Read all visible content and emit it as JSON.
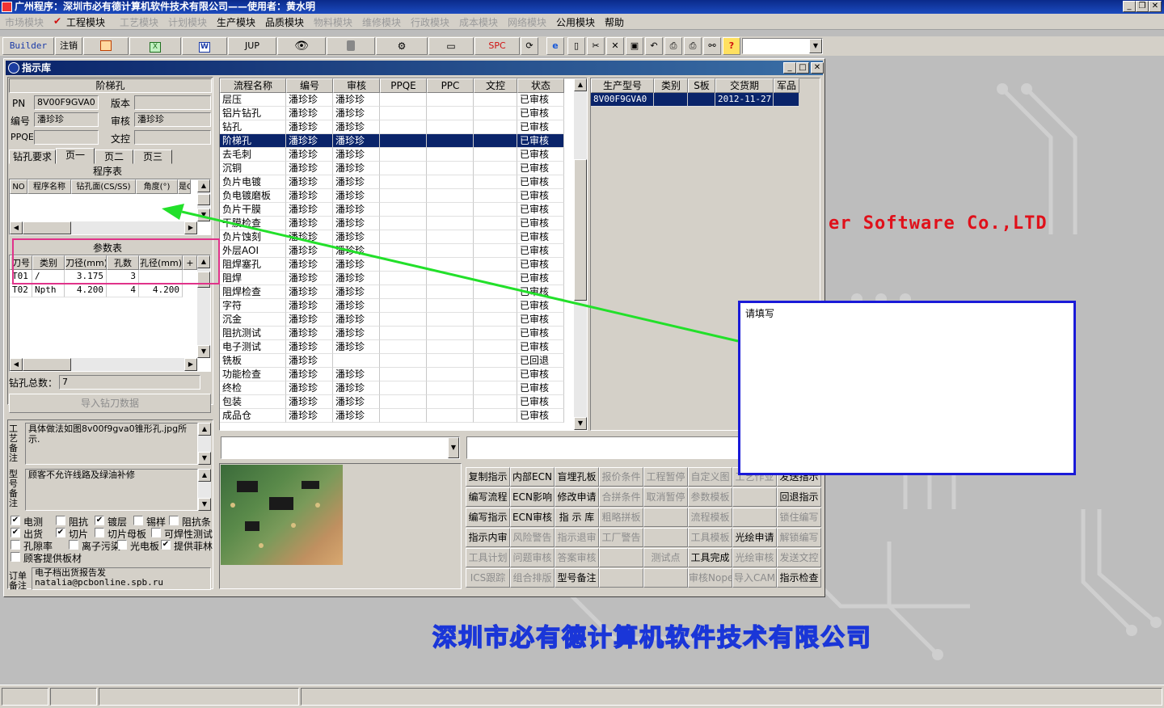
{
  "app": {
    "title": "广州程序：深圳市必有德计算机软件技术有限公司——使用者：黄水明"
  },
  "menu": [
    {
      "label": "市场模块",
      "enabled": false
    },
    {
      "label": "工程模块",
      "enabled": true,
      "checked": true
    },
    {
      "label": "工艺模块",
      "enabled": false
    },
    {
      "label": "计划模块",
      "enabled": false
    },
    {
      "label": "生产模块",
      "enabled": true
    },
    {
      "label": "品质模块",
      "enabled": true
    },
    {
      "label": "物料模块",
      "enabled": false
    },
    {
      "label": "维修模块",
      "enabled": false
    },
    {
      "label": "行政模块",
      "enabled": false
    },
    {
      "label": "成本模块",
      "enabled": false
    },
    {
      "label": "网络模块",
      "enabled": false
    },
    {
      "label": "公用模块",
      "enabled": true
    },
    {
      "label": "帮助",
      "enabled": true
    }
  ],
  "toolbar": {
    "builder": "Builder",
    "logout": "注销",
    "jup": "JUP",
    "spc": "SPC",
    "combo_value": ""
  },
  "window": {
    "title": "指示库"
  },
  "left": {
    "product_type": "阶梯孔",
    "pn_label": "PN",
    "pn_value": "8V00F9GVA0",
    "version_label": "版本",
    "version_value": "",
    "editor_label": "编号",
    "editor_value": "潘珍珍",
    "review_label": "审核",
    "review_value": "潘珍珍",
    "ppqe_label": "PPQE",
    "ppqe_value": "",
    "doc_label": "文控",
    "doc_value": "",
    "tabs": [
      "钻孔要求",
      "页一",
      "页二",
      "页三"
    ],
    "program_table_title": "程序表",
    "program_cols": [
      "NO",
      "程序名称",
      "钻孔面(CS/SS)",
      "角度(°)",
      "是Q"
    ],
    "param_table_title": "参数表",
    "param_cols": [
      "刀号",
      "类别",
      "刀径(mm)",
      "孔数",
      "孔径(mm)",
      "+"
    ],
    "param_rows": [
      [
        "T01",
        "/",
        "3.175",
        "3",
        ""
      ],
      [
        "T02",
        "Npth",
        "4.200",
        "4",
        "4.200"
      ]
    ],
    "drill_total_label": "钻孔总数：",
    "drill_total_value": "7",
    "import_button": "导入钻刀数据",
    "process_note_label": "工艺备注",
    "process_note": "具体做法如图8v00f9gva0锥形孔.jpg所示.",
    "type_note_label": "型号备注",
    "type_note": "顾客不允许线路及绿油补修",
    "checkboxes": [
      {
        "label": "电测",
        "checked": true
      },
      {
        "label": "阻抗",
        "checked": false
      },
      {
        "label": "镀层",
        "checked": true
      },
      {
        "label": "锡样",
        "checked": false
      },
      {
        "label": "阻抗条",
        "checked": false
      },
      {
        "label": "出货",
        "checked": true
      },
      {
        "label": "切片",
        "checked": true
      },
      {
        "label": "切片母板",
        "checked": false
      },
      {
        "label": "可焊性测试",
        "checked": false
      },
      {
        "label": "孔隙率",
        "checked": false
      },
      {
        "label": "离子污染",
        "checked": false
      },
      {
        "label": "光电板",
        "checked": false
      },
      {
        "label": "提供菲林",
        "checked": true
      },
      {
        "label": "顾客提供板材",
        "checked": false
      }
    ],
    "order_note_label": "订单备注",
    "order_note": "电子档出货报告发\nnatalia@pcbonline.spb.ru"
  },
  "flow": {
    "cols": [
      "流程名称",
      "编号",
      "审核",
      "PPQE",
      "PPC",
      "文控",
      "状态"
    ],
    "rows": [
      [
        "层压",
        "潘珍珍",
        "潘珍珍",
        "",
        "",
        "",
        "已审核"
      ],
      [
        "铝片钻孔",
        "潘珍珍",
        "潘珍珍",
        "",
        "",
        "",
        "已审核"
      ],
      [
        "钻孔",
        "潘珍珍",
        "潘珍珍",
        "",
        "",
        "",
        "已审核"
      ],
      [
        "阶梯孔",
        "潘珍珍",
        "潘珍珍",
        "",
        "",
        "",
        "已审核"
      ],
      [
        "去毛刺",
        "潘珍珍",
        "潘珍珍",
        "",
        "",
        "",
        "已审核"
      ],
      [
        "沉铜",
        "潘珍珍",
        "潘珍珍",
        "",
        "",
        "",
        "已审核"
      ],
      [
        "负片电镀",
        "潘珍珍",
        "潘珍珍",
        "",
        "",
        "",
        "已审核"
      ],
      [
        "负电镀磨板",
        "潘珍珍",
        "潘珍珍",
        "",
        "",
        "",
        "已审核"
      ],
      [
        "负片干膜",
        "潘珍珍",
        "潘珍珍",
        "",
        "",
        "",
        "已审核"
      ],
      [
        "干膜检查",
        "潘珍珍",
        "潘珍珍",
        "",
        "",
        "",
        "已审核"
      ],
      [
        "负片蚀刻",
        "潘珍珍",
        "潘珍珍",
        "",
        "",
        "",
        "已审核"
      ],
      [
        "外层AOI",
        "潘珍珍",
        "潘珍珍",
        "",
        "",
        "",
        "已审核"
      ],
      [
        "阻焊塞孔",
        "潘珍珍",
        "潘珍珍",
        "",
        "",
        "",
        "已审核"
      ],
      [
        "阻焊",
        "潘珍珍",
        "潘珍珍",
        "",
        "",
        "",
        "已审核"
      ],
      [
        "阻焊检查",
        "潘珍珍",
        "潘珍珍",
        "",
        "",
        "",
        "已审核"
      ],
      [
        "字符",
        "潘珍珍",
        "潘珍珍",
        "",
        "",
        "",
        "已审核"
      ],
      [
        "沉金",
        "潘珍珍",
        "潘珍珍",
        "",
        "",
        "",
        "已审核"
      ],
      [
        "阻抗测试",
        "潘珍珍",
        "潘珍珍",
        "",
        "",
        "",
        "已审核"
      ],
      [
        "电子测试",
        "潘珍珍",
        "潘珍珍",
        "",
        "",
        "",
        "已审核"
      ],
      [
        "铣板",
        "潘珍珍",
        "",
        "",
        "",
        "",
        "已回退"
      ],
      [
        "功能检查",
        "潘珍珍",
        "潘珍珍",
        "",
        "",
        "",
        "已审核"
      ],
      [
        "终检",
        "潘珍珍",
        "潘珍珍",
        "",
        "",
        "",
        "已审核"
      ],
      [
        "包装",
        "潘珍珍",
        "潘珍珍",
        "",
        "",
        "",
        "已审核"
      ],
      [
        "成品仓",
        "潘珍珍",
        "潘珍珍",
        "",
        "",
        "",
        "已审核"
      ]
    ],
    "selected_index": 3
  },
  "prod": {
    "cols": [
      "生产型号",
      "类别",
      "S板",
      "交货期",
      "军品"
    ],
    "rows": [
      [
        "8V00F9GVA0",
        "",
        "",
        "2012-11-27",
        ""
      ]
    ]
  },
  "bottom": {
    "combo_value": "",
    "text_value": ""
  },
  "actions": [
    [
      {
        "label": "复制指示",
        "enabled": true
      },
      {
        "label": "内部ECN",
        "enabled": true
      },
      {
        "label": "盲埋孔板",
        "enabled": true
      },
      {
        "label": "报价条件",
        "enabled": false
      },
      {
        "label": "工程暂停",
        "enabled": false
      },
      {
        "label": "自定义图",
        "enabled": false
      },
      {
        "label": "工艺作业",
        "enabled": false
      },
      {
        "label": "发送指示",
        "enabled": true
      }
    ],
    [
      {
        "label": "编写流程",
        "enabled": true
      },
      {
        "label": "ECN影响",
        "enabled": true
      },
      {
        "label": "修改申请",
        "enabled": true
      },
      {
        "label": "合拼条件",
        "enabled": false
      },
      {
        "label": "取消暂停",
        "enabled": false
      },
      {
        "label": "参数模板",
        "enabled": false
      },
      {
        "label": "",
        "enabled": false
      },
      {
        "label": "回退指示",
        "enabled": true
      }
    ],
    [
      {
        "label": "编写指示",
        "enabled": true
      },
      {
        "label": "ECN审核",
        "enabled": true
      },
      {
        "label": "指 示 库",
        "enabled": true
      },
      {
        "label": "粗略拼板",
        "enabled": false
      },
      {
        "label": "",
        "enabled": false
      },
      {
        "label": "流程模板",
        "enabled": false
      },
      {
        "label": "",
        "enabled": false
      },
      {
        "label": "锁住编写",
        "enabled": false
      }
    ],
    [
      {
        "label": "指示内审",
        "enabled": true
      },
      {
        "label": "风险警告",
        "enabled": false
      },
      {
        "label": "指示退审",
        "enabled": false
      },
      {
        "label": "工厂警告",
        "enabled": false
      },
      {
        "label": "",
        "enabled": false
      },
      {
        "label": "工具模板",
        "enabled": false
      },
      {
        "label": "光绘申请",
        "enabled": true
      },
      {
        "label": "解锁编写",
        "enabled": false
      }
    ],
    [
      {
        "label": "工具计划",
        "enabled": false
      },
      {
        "label": "问题审核",
        "enabled": false
      },
      {
        "label": "答案审核",
        "enabled": false
      },
      {
        "label": "",
        "enabled": false
      },
      {
        "label": "测试点",
        "enabled": false
      },
      {
        "label": "工具完成",
        "enabled": true
      },
      {
        "label": "光绘审核",
        "enabled": false
      },
      {
        "label": "发送文控",
        "enabled": false
      }
    ],
    [
      {
        "label": "ICS跟踪",
        "enabled": false
      },
      {
        "label": "组合排版",
        "enabled": false
      },
      {
        "label": "型号备注",
        "enabled": true
      },
      {
        "label": "",
        "enabled": false
      },
      {
        "label": "",
        "enabled": false
      },
      {
        "label": "审核Nope",
        "enabled": false
      },
      {
        "label": "导入CAM",
        "enabled": false
      },
      {
        "label": "指示检查",
        "enabled": true
      }
    ]
  ],
  "annotation": {
    "note_label": "请填写"
  },
  "branding": {
    "en": "er Software Co.,LTD",
    "cn": "深圳市必有德计算机软件技术有限公司"
  },
  "colors": {
    "title_bar": "#0a246a",
    "selection": "#0a246a",
    "annotation_pink": "#e0338a",
    "annotation_green": "#22e02a",
    "annotation_blue": "#1a1ad8",
    "brand_red": "#e0101a"
  }
}
